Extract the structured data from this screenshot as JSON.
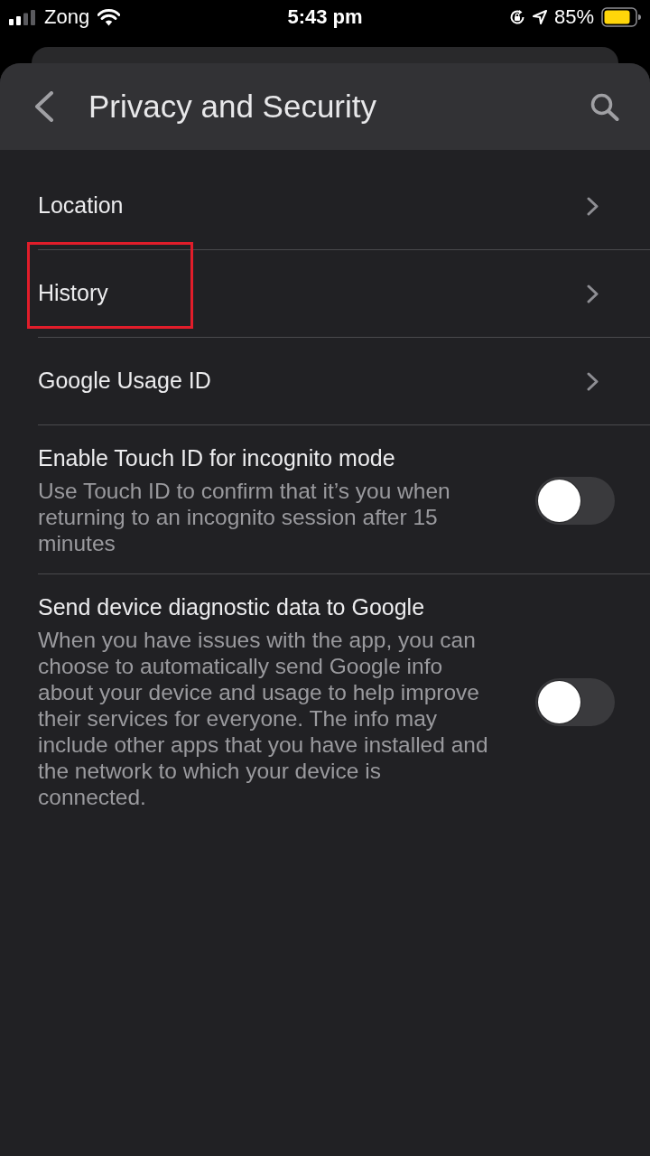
{
  "status_bar": {
    "carrier": "Zong",
    "time": "5:43 pm",
    "battery": "85%"
  },
  "header": {
    "title": "Privacy and Security"
  },
  "items": [
    {
      "kind": "link",
      "label": "Location",
      "highlighted": false
    },
    {
      "kind": "link",
      "label": "History",
      "highlighted": true
    },
    {
      "kind": "link",
      "label": "Google Usage ID",
      "highlighted": false
    },
    {
      "kind": "toggle",
      "label": "Enable Touch ID for incognito mode",
      "description": "Use Touch ID to confirm that it’s you when returning to an incognito session after 15 minutes",
      "on": false,
      "highlighted": false
    },
    {
      "kind": "toggle",
      "label": "Send device diagnostic data to Google",
      "description": "When you have issues with the app, you can choose to automatically send Google info about your device and usage to help improve their services for everyone. The info may include other apps that you have installed and the network to which your device is connected.",
      "on": false,
      "highlighted": false
    }
  ]
}
